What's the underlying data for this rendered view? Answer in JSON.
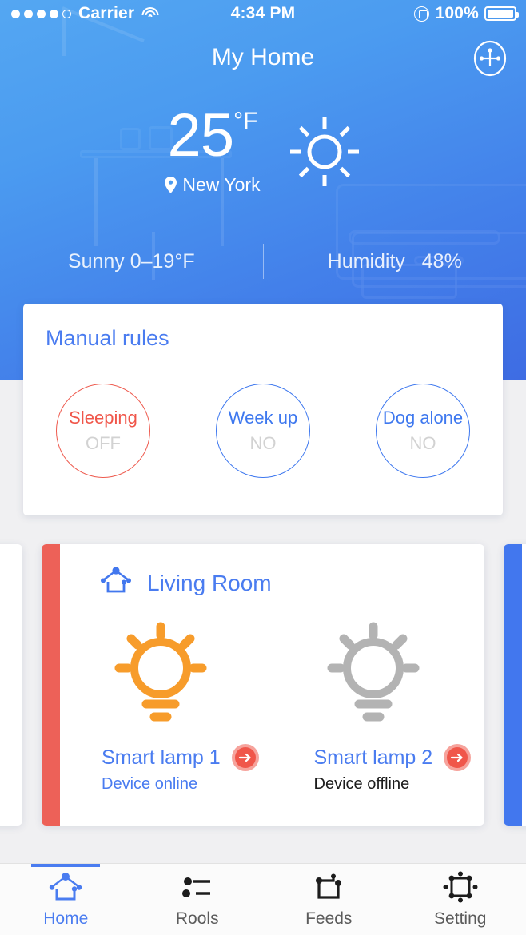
{
  "status_bar": {
    "carrier": "Carrier",
    "signal_dots_filled": 4,
    "signal_dots_total": 5,
    "wifi_icon": "wifi-icon",
    "time": "4:34 PM",
    "rotation_lock_icon": "rotation-lock-icon",
    "battery_percent": "100%",
    "battery_icon": "battery-full-icon"
  },
  "navbar": {
    "title": "My Home",
    "action_icon": "add-device-crosshair-icon"
  },
  "weather": {
    "temperature": "25",
    "unit": "°F",
    "condition_icon": "sun-icon",
    "location_icon": "location-pin-icon",
    "location": "New York",
    "condition_range": "Sunny 0–19°F",
    "humidity_label": "Humidity",
    "humidity_value": "48%"
  },
  "manual_rules": {
    "title": "Manual rules",
    "items": [
      {
        "name": "Sleeping",
        "state": "OFF",
        "color": "#f0564a"
      },
      {
        "name": "Week up",
        "state": "NO",
        "color": "#3e78ef"
      },
      {
        "name": "Dog alone",
        "state": "NO",
        "color": "#3e78ef"
      }
    ]
  },
  "room_card": {
    "house_icon": "house-node-icon",
    "name": "Living Room",
    "accent_color": "#ed6158",
    "next_accent_color": "#4277ee",
    "devices": [
      {
        "icon": "lamp-on-icon",
        "icon_color": "#f79c2b",
        "name": "Smart lamp 1",
        "status": "Device online",
        "status_state": "online",
        "arrow_icon": "arrow-right-icon"
      },
      {
        "icon": "lamp-off-icon",
        "icon_color": "#b3b3b3",
        "name": "Smart lamp 2",
        "status": "Device offline",
        "status_state": "offline",
        "arrow_icon": "arrow-right-icon"
      }
    ]
  },
  "tabbar": {
    "items": [
      {
        "label": "Home",
        "icon": "house-node-icon",
        "active": true
      },
      {
        "label": "Rools",
        "icon": "rules-list-icon",
        "active": false
      },
      {
        "label": "Feeds",
        "icon": "feeds-icon",
        "active": false
      },
      {
        "label": "Setting",
        "icon": "setting-frame-icon",
        "active": false
      }
    ]
  },
  "colors": {
    "brand_blue": "#4a7cf0",
    "hero_top": "#54a7f2",
    "hero_bottom": "#3e6ce3",
    "accent_red": "#f0564a",
    "lamp_on_orange": "#f79c2b",
    "lamp_off_gray": "#b3b3b3"
  }
}
